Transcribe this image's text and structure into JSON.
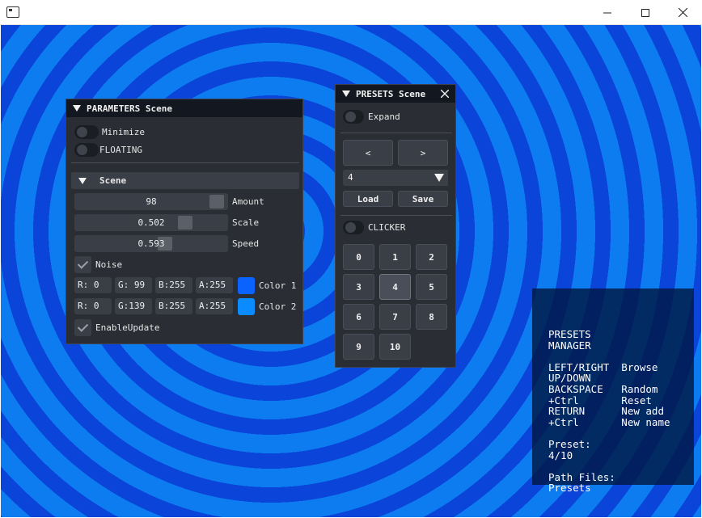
{
  "window": {
    "title": ""
  },
  "parameters_panel": {
    "title": "PARAMETERS Scene",
    "minimize_label": "Minimize",
    "floating_label": "FLOATING",
    "section_title": "Scene",
    "amount": {
      "value": "98",
      "label": "Amount"
    },
    "scale": {
      "value": "0.502",
      "label": "Scale"
    },
    "speed": {
      "value": "0.593",
      "label": "Speed"
    },
    "noise_label": "Noise",
    "color1": {
      "r": "R:  0",
      "g": "G: 99",
      "b": "B:255",
      "a": "A:255",
      "label": "Color 1",
      "hex": "#0a63ff"
    },
    "color2": {
      "r": "R:  0",
      "g": "G:139",
      "b": "B:255",
      "a": "A:255",
      "label": "Color 2",
      "hex": "#0a8bff"
    },
    "enable_update_label": "EnableUpdate"
  },
  "presets_panel": {
    "title": "PRESETS Scene",
    "expand_label": "Expand",
    "prev_label": "<",
    "next_label": ">",
    "combo_value": "4",
    "load_label": "Load",
    "save_label": "Save",
    "clicker_label": "CLICKER",
    "clicker_buttons": [
      "0",
      "1",
      "2",
      "3",
      "4",
      "5",
      "6",
      "7",
      "8",
      "9",
      "10"
    ],
    "selected": "4"
  },
  "info_overlay": {
    "lines": [
      "PRESETS",
      "MANAGER",
      "",
      "LEFT/RIGHT  Browse",
      "UP/DOWN",
      "BACKSPACE   Random",
      "+Ctrl       Reset",
      "RETURN      New add",
      "+Ctrl       New name",
      "",
      "Preset:",
      "4/10",
      "",
      "Path Files:",
      "Presets"
    ]
  },
  "colors": {
    "ring_light": "#0d7cf0",
    "ring_dark": "#0a44d8",
    "panel_bg": "#2a2d33",
    "header_bg": "#131820"
  }
}
